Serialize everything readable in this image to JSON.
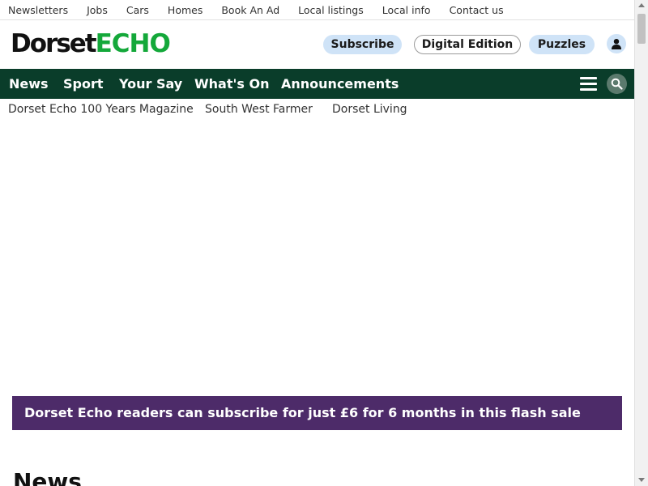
{
  "util_links": [
    "Newsletters",
    "Jobs",
    "Cars",
    "Homes",
    "Book An Ad",
    "Local listings",
    "Local info",
    "Contact us"
  ],
  "logo": {
    "part1": "Dorset",
    "part2": "ECHO"
  },
  "header_buttons": {
    "subscribe": "Subscribe",
    "digital_edition": "Digital Edition",
    "puzzles": "Puzzles"
  },
  "main_nav": [
    "News",
    "Sport",
    "Your Say",
    "What's On",
    "Announcements"
  ],
  "sub_nav": [
    "Dorset Echo 100 Years Magazine",
    "South West Farmer",
    "Dorset Living"
  ],
  "promo": {
    "text": "Dorset Echo readers can subscribe for just £6 for 6 months in this flash sale",
    "color": "#4d2b69"
  },
  "section_heading": "News",
  "icons": {
    "user": "user-icon",
    "menu": "menu-icon",
    "search": "search-icon"
  },
  "colors": {
    "nav_bg": "#0a3d2a",
    "brand_green": "#14a83a",
    "pill_blue": "#cfe3f7"
  }
}
